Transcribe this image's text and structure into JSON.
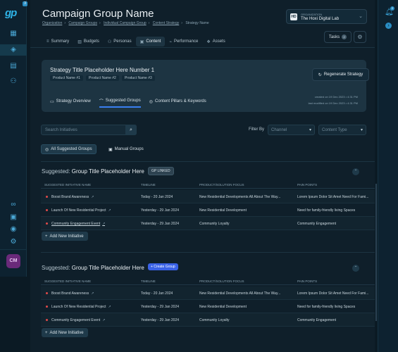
{
  "app": {
    "logo_text": "gp",
    "logo_badge": "3"
  },
  "left_rail": {
    "icons": [
      "grid-icon",
      "layers-icon",
      "calendar-icon",
      "users-icon",
      "link-icon",
      "document-icon",
      "target-icon",
      "settings-icon"
    ],
    "avatar": "CM"
  },
  "right_rail": {
    "bell_badge": "2"
  },
  "header": {
    "title": "Campaign Group Name",
    "breadcrumbs": [
      "Organization",
      "Campaign Groups",
      "Individual Campaign Group",
      "Content Strategy",
      "Strategy Name"
    ],
    "org": {
      "caption": "ORGANIZATION",
      "name": "The Hoxi Digital Lab",
      "logo": "HD"
    }
  },
  "tabs": [
    {
      "label": "Summary",
      "icon": "list-icon",
      "active": false
    },
    {
      "label": "Budgets",
      "icon": "budget-icon",
      "active": false
    },
    {
      "label": "Personas",
      "icon": "person-icon",
      "active": false
    },
    {
      "label": "Content",
      "icon": "content-icon",
      "active": true
    },
    {
      "label": "Performance",
      "icon": "chart-icon",
      "active": false
    },
    {
      "label": "Assets",
      "icon": "assets-icon",
      "active": false
    }
  ],
  "toolbar": {
    "tasks_label": "Tasks",
    "tasks_count": "2"
  },
  "strategy": {
    "title": "Strategy Title Placeholder Here Number 1",
    "products": [
      "Product Name #1",
      "Product Name #2",
      "Product Name #3"
    ],
    "regenerate_label": "Regenerate Strategy",
    "tabs": [
      {
        "label": "Strategy Overview",
        "active": false
      },
      {
        "label": "Suggested Groups",
        "active": true
      },
      {
        "label": "Content Pillars & Keywords",
        "active": false
      }
    ],
    "meta": {
      "created_label": "created on",
      "created_value": "19 Dec 2023 • 4:31 PM",
      "updated_label": "last modified on",
      "updated_value": "19 Dec 2023 • 4:31 PM"
    }
  },
  "filters": {
    "search_placeholder": "Search Initiatives",
    "filter_by_label": "Filter By",
    "channel_placeholder": "Channel",
    "content_type_placeholder": "Content Type"
  },
  "segments": {
    "all_label": "All Suggested Groups",
    "manual_label": "Manual Groups"
  },
  "table_headers": [
    "SUGGESTED INITIATIVE NAME",
    "TIMELINE",
    "PRODUCT/SOLUTION FOCUS",
    "PAIN POINTS"
  ],
  "groups": [
    {
      "prefix": "Suggested:",
      "title": "Group Title Placeholder Here",
      "badge": "GP LINKED",
      "rows": [
        {
          "name": "Boost Brand Awareness",
          "timeline": "Today - 20 Jan 2024",
          "focus": "New Residential Developments All About The Way...",
          "pain": "Lorem Ipsum Dolor Sit Amet Need For Fami..."
        },
        {
          "name": "Launch Of New Residential Project",
          "timeline": "Yesterday - 29 Jan 2024",
          "focus": "New Residential Development",
          "pain": "Need for family-friendly living Spaces"
        },
        {
          "name": "Community Engagement Event",
          "timeline": "Yesterday - 29 Jan 2024",
          "focus": "Community Loyalty",
          "pain": "Community Engagement"
        }
      ],
      "add_label": "Add New Initiative"
    },
    {
      "prefix": "Suggested:",
      "title": "Group Title Placeholder Here",
      "badge": "+ Create Group",
      "rows": [
        {
          "name": "Boost Brand Awareness",
          "timeline": "Today - 20 Jan 2024",
          "focus": "New Residential Developments All About The Way...",
          "pain": "Lorem Ipsum Dolor Sit Amet Need For Fami..."
        },
        {
          "name": "Launch Of New Residential Project",
          "timeline": "Yesterday - 29 Jan 2024",
          "focus": "New Residential Development",
          "pain": "Need for family-friendly living Spaces"
        },
        {
          "name": "Community Engagement Event",
          "timeline": "Yesterday - 29 Jan 2024",
          "focus": "Community Loyalty",
          "pain": "Community Engagement"
        }
      ],
      "add_label": "Add New Initiative"
    }
  ],
  "colors": {
    "accent": "#3a62e6",
    "brand": "#2fb4e8",
    "danger_dot": "#e04a4a",
    "background": "#0f1f2a"
  }
}
